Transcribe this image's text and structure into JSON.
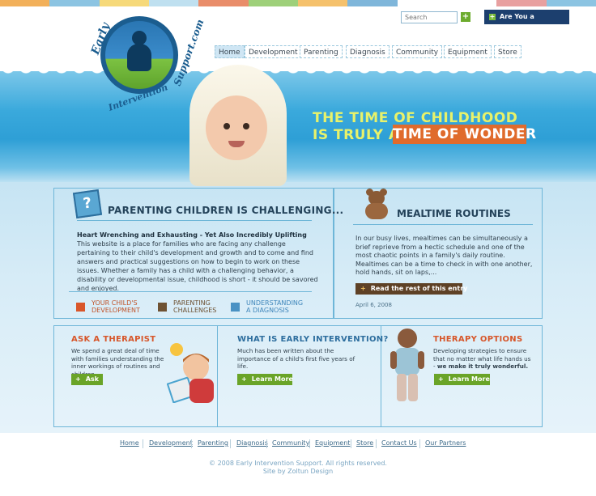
{
  "brand": {
    "logo_text": "Early Intervention Support.com",
    "logo_parts": [
      "Early",
      "Intervention",
      "Support.com"
    ]
  },
  "search": {
    "placeholder": "Search"
  },
  "therapist_button": "Are You a Therapist?",
  "nav": [
    "Home",
    "Development",
    "Parenting",
    "Diagnosis",
    "Community",
    "Equipment",
    "Store"
  ],
  "hero": {
    "line1": "THE TIME OF CHILDHOOD",
    "line2": "IS TRULY A",
    "highlight": "TIME OF WONDER"
  },
  "parenting": {
    "heading": "PARENTING CHILDREN IS CHALLENGING...",
    "subheading": "Heart Wrenching and Exhausting - Yet Also Incredibly Uplifting",
    "body": "This website is a place for families who are facing any challenge pertaining to their child's development and growth and to come and find answers and practical suggestions on how to begin to work on these issues. Whether a family has a child with a challenging behavior, a disability or developmental issue, childhood is short - it should be savored and enjoyed.",
    "links": [
      {
        "label": "YOUR CHILD'S DEVELOPMENT"
      },
      {
        "label": "PARENTING CHALLENGES"
      },
      {
        "label": "UNDERSTANDING A DIAGNOSIS"
      }
    ]
  },
  "mealtime": {
    "heading": "MEALTIME ROUTINES",
    "body": "In our busy lives, mealtimes can be simultaneously a brief reprieve from a hectic schedule and one of the most chaotic points in a family's daily routine. Mealtimes can be a time to check in with one another, hold hands, sit on laps,...",
    "button": "Read the rest of this entry",
    "date": "April 6, 2008"
  },
  "ask": {
    "heading": "ASK A THERAPIST",
    "body": "We spend a great deal of time with families understanding the inner workings of routines and children.",
    "button": "Ask"
  },
  "what": {
    "heading": "WHAT IS EARLY INTERVENTION?",
    "body": "Much has been written about the importance of a child's first five years of life.",
    "button": "Learn More"
  },
  "therapy": {
    "heading": "THERAPY OPTIONS",
    "body": "Developing strategies to ensure that no matter what life hands us -",
    "body_bold": "we make it truly wonderful.",
    "button": "Learn More"
  },
  "footer": {
    "links": [
      "Home",
      "Development",
      "Parenting",
      "Diagnosis",
      "Community",
      "Equipment",
      "Store",
      "Contact Us",
      "Our Partners"
    ],
    "copyright": "© 2008 Early Intervention Support. All rights reserved.",
    "credit": "Site by Zoltun Design"
  },
  "colors": {
    "accent_orange": "#e06b2c",
    "accent_green": "#6aa428",
    "navy": "#1c3f6e",
    "hero_yellow": "#e8f26a"
  }
}
